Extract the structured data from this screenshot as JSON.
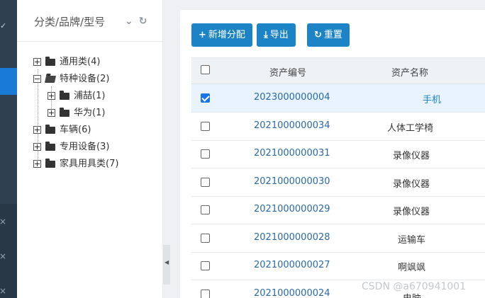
{
  "sidebar_tree": {
    "title": "分类/品牌/型号",
    "nodes": [
      {
        "label": "通用类(4)"
      },
      {
        "label": "特种设备(2)"
      },
      {
        "label": "浦喆(1)"
      },
      {
        "label": "华为(1)"
      },
      {
        "label": "车辆(6)"
      },
      {
        "label": "专用设备(3)"
      },
      {
        "label": "家具用具类(7)"
      }
    ]
  },
  "toolbar": {
    "add_label": "新增分配",
    "export_label": "导出",
    "reset_label": "重置"
  },
  "table": {
    "headers": {
      "code": "资产编号",
      "name": "资产名称"
    },
    "rows": [
      {
        "code": "2023000000004",
        "name": "手机",
        "checked": true
      },
      {
        "code": "2021000000034",
        "name": "人体工学椅",
        "checked": false
      },
      {
        "code": "2021000000031",
        "name": "录像仪器",
        "checked": false
      },
      {
        "code": "2021000000030",
        "name": "录像仪器",
        "checked": false
      },
      {
        "code": "2021000000029",
        "name": "录像仪器",
        "checked": false
      },
      {
        "code": "2021000000028",
        "name": "运输车",
        "checked": false
      },
      {
        "code": "2021000000027",
        "name": "啊飒飒",
        "checked": false
      },
      {
        "code": "2021000000024",
        "name": "电脑",
        "checked": false
      }
    ]
  },
  "watermark": "CSDN @a670941001",
  "colors": {
    "primary": "#1c84c6",
    "nav_bg": "#2f4050",
    "nav_active": "#1a7bd6"
  }
}
